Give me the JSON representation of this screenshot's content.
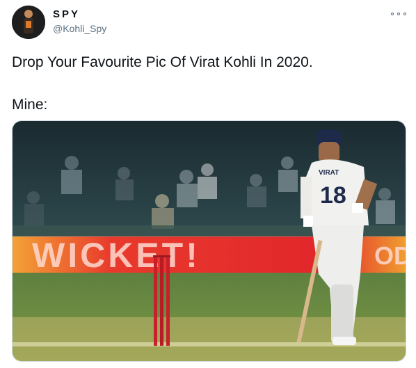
{
  "user": {
    "display_name": "SPY",
    "handle": "@Kohli_Spy",
    "avatar_icon": "profile-photo"
  },
  "tweet": {
    "line1": "Drop Your Favourite Pic Of Virat Kohli In 2020.",
    "line2": "Mine:"
  },
  "media": {
    "board_text": "WICKET!",
    "board_text_right": "OD",
    "jersey_name": "VIRAT",
    "jersey_number": "18"
  },
  "colors": {
    "board_red": "#e32b2b",
    "board_orange": "#f59a2d",
    "grass": "#6f8f3a",
    "pitch": "#c9b76c",
    "stumps": "#c8202a"
  }
}
